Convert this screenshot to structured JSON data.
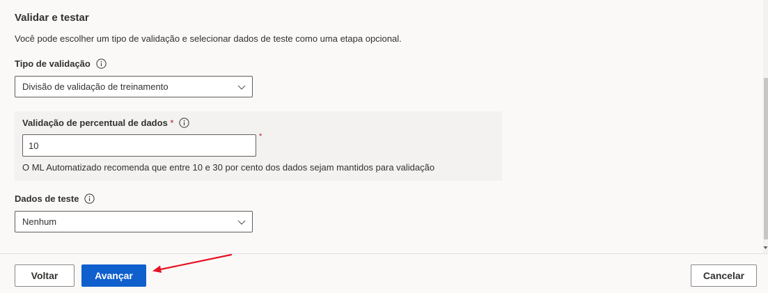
{
  "section": {
    "title": "Validar e testar",
    "description": "Você pode escolher um tipo de validação e selecionar dados de teste como uma etapa opcional."
  },
  "validation_type": {
    "label": "Tipo de validação",
    "selected": "Divisão de validação de treinamento"
  },
  "percent_validation": {
    "label": "Validação de percentual de dados",
    "required_mark": "*",
    "value": "10",
    "hint": "O ML Automatizado recomenda que entre 10 e 30 por cento dos dados sejam mantidos para validação"
  },
  "test_data": {
    "label": "Dados de teste",
    "selected": "Nenhum"
  },
  "footer": {
    "back_label": "Voltar",
    "next_label": "Avançar",
    "cancel_label": "Cancelar"
  },
  "colors": {
    "primary": "#0f5fcd",
    "required": "#a4262c",
    "annotation_arrow": "#e81123"
  },
  "icons": {
    "info": "info-icon",
    "dropdown": "chevron-down-icon",
    "annotation": "red-arrow-icon"
  }
}
